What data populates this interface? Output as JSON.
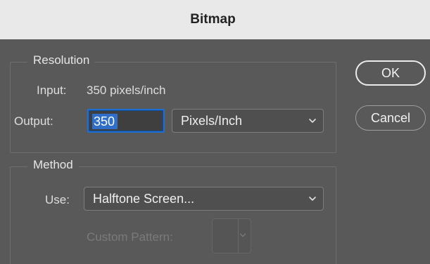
{
  "window": {
    "title": "Bitmap"
  },
  "resolution": {
    "group_label": "Resolution",
    "input_label": "Input:",
    "input_value": "350 pixels/inch",
    "output_label": "Output:",
    "output_value": "350",
    "unit_selected": "Pixels/Inch"
  },
  "method": {
    "group_label": "Method",
    "use_label": "Use:",
    "use_selected": "Halftone Screen...",
    "custom_pattern_label": "Custom Pattern:"
  },
  "buttons": {
    "ok": "OK",
    "cancel": "Cancel"
  },
  "icons": {
    "dropdown": "chevron-down-icon"
  },
  "colors": {
    "title_bar": "#e9e9e9",
    "dialog_bg": "#595959",
    "selection": "#2f6ec9",
    "focus_ring": "#1e6fd0"
  }
}
